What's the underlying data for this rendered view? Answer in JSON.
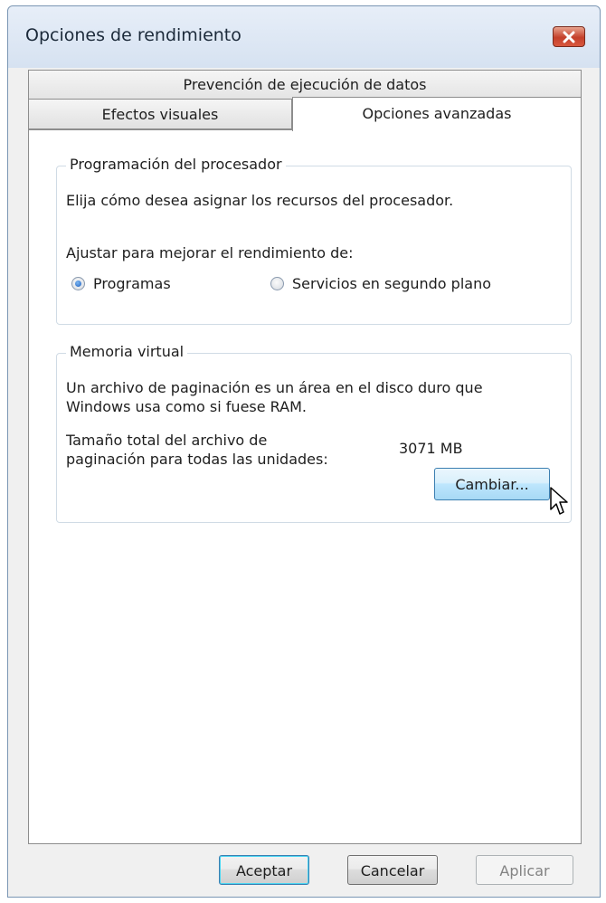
{
  "window": {
    "title": "Opciones de rendimiento",
    "close_icon": "close-icon"
  },
  "tabs": [
    {
      "label": "Prevención de ejecución de datos",
      "active": false
    },
    {
      "label": "Efectos visuales",
      "active": false
    },
    {
      "label": "Opciones avanzadas",
      "active": true
    }
  ],
  "processor": {
    "legend": "Programación del procesador",
    "description": "Elija cómo desea asignar los recursos del procesador.",
    "adjust_label": "Ajustar para mejorar el rendimiento de:",
    "options": [
      {
        "label": "Programas",
        "checked": true
      },
      {
        "label": "Servicios en segundo plano",
        "checked": false
      }
    ]
  },
  "virtual_memory": {
    "legend": "Memoria virtual",
    "description_line1": "Un archivo de paginación es un área en el disco duro que",
    "description_line2": "Windows usa como si fuese RAM.",
    "total_label_line1": "Tamaño total del archivo de",
    "total_label_line2": "paginación para todas las unidades:",
    "total_value": "3071 MB",
    "change_button": "Cambiar..."
  },
  "footer": {
    "ok": "Aceptar",
    "cancel": "Cancelar",
    "apply": "Aplicar",
    "apply_enabled": false
  },
  "colors": {
    "title_bar": "#dfe8f4",
    "close_button": "#c4402b",
    "focus_border": "#3c7fb1"
  }
}
